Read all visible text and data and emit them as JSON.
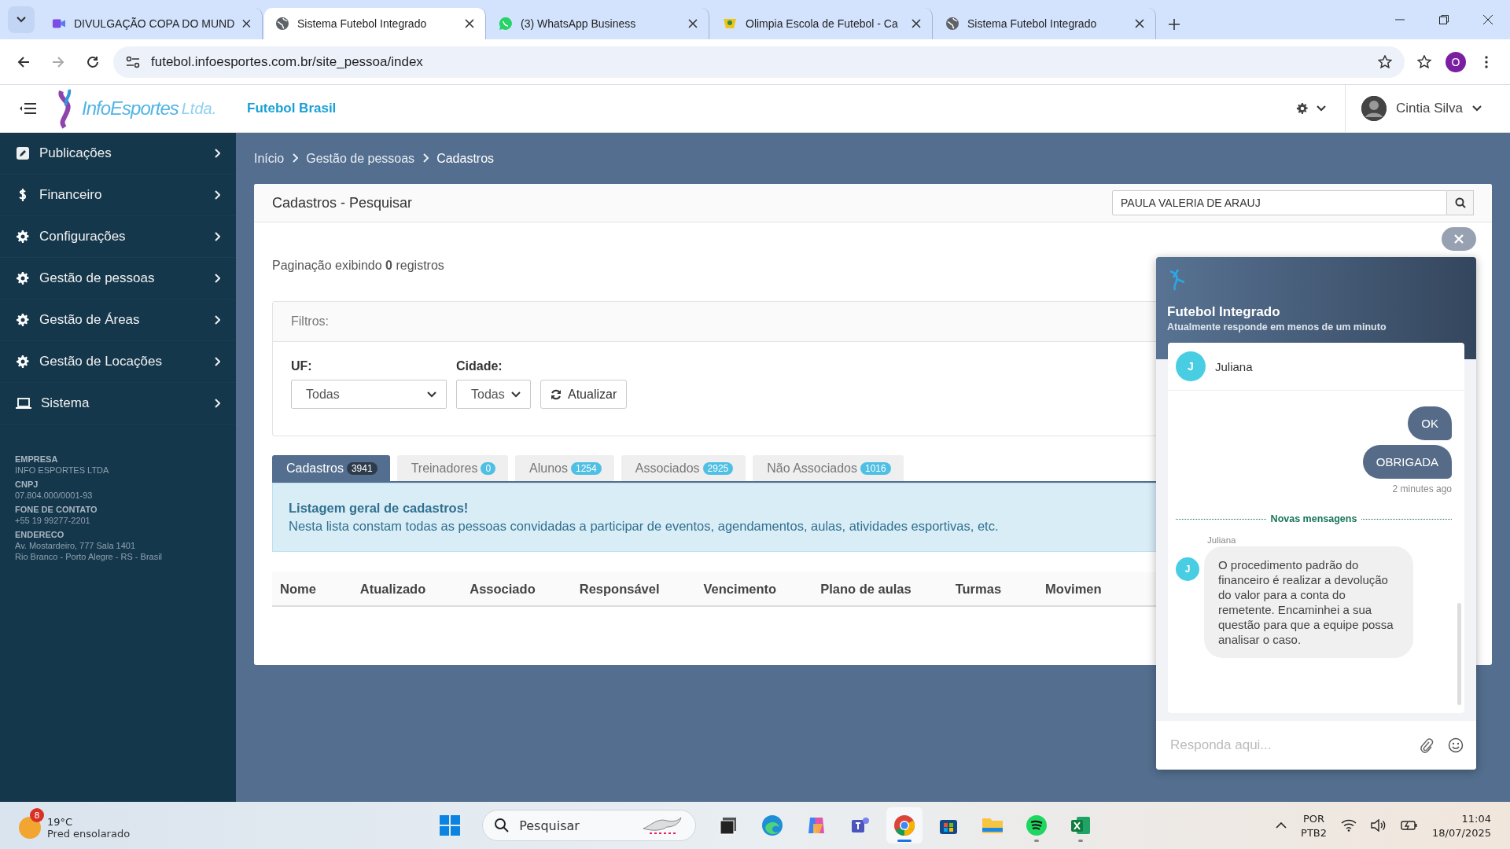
{
  "browser": {
    "tabs": [
      {
        "kind": "video",
        "title": "DIVULGAÇÃO COPA DO MUND",
        "selected": false
      },
      {
        "kind": "globe",
        "title": "Sistema Futebol Integrado",
        "selected": true
      },
      {
        "kind": "whatsapp",
        "title": "(3) WhatsApp Business",
        "selected": false
      },
      {
        "kind": "image",
        "title": "Olimpia Escola de Futebol - Ca",
        "selected": false
      },
      {
        "kind": "globe",
        "title": "Sistema Futebol Integrado",
        "selected": false
      }
    ],
    "url": "futebol.infoesportes.com.br/site_pessoa/index",
    "profile": "O"
  },
  "header": {
    "logo_main": "InfoEsportes",
    "logo_suffix": "Ltda.",
    "org": "Futebol Brasil",
    "user": "Cintia Silva"
  },
  "sidebar": {
    "items": [
      {
        "kind": "edit",
        "label": "Publicações"
      },
      {
        "kind": "money",
        "label": "Financeiro"
      },
      {
        "kind": "gear",
        "label": "Configurações"
      },
      {
        "kind": "gear",
        "label": "Gestão de pessoas"
      },
      {
        "kind": "gear",
        "label": "Gestão de Áreas"
      },
      {
        "kind": "gear",
        "label": "Gestão de Locações"
      },
      {
        "kind": "laptop",
        "label": "Sistema"
      }
    ],
    "info": [
      {
        "label": "EMPRESA",
        "lines": [
          "INFO ESPORTES LTDA"
        ]
      },
      {
        "label": "CNPJ",
        "lines": [
          "07.804.000/0001-93"
        ]
      },
      {
        "label": "FONE DE CONTATO",
        "lines": [
          "+55 19 99277-2201"
        ]
      },
      {
        "label": "ENDERECO",
        "lines": [
          "Av. Mostardeiro, 777 Sala 1401",
          "Rio Branco - Porto Alegre - RS - Brasil"
        ]
      }
    ]
  },
  "breadcrumb": [
    "Início",
    "Gestão de pessoas",
    "Cadastros"
  ],
  "card": {
    "title": "Cadastros - Pesquisar",
    "search": {
      "value": "PAULA VALERIA DE ARAUJ"
    },
    "pagination": "Paginação exibindo **0** registros",
    "filters": {
      "title": "Filtros:",
      "fields": [
        {
          "label": "UF:",
          "value": "Todas"
        },
        {
          "label": "Cidade:",
          "value": "Todas"
        }
      ],
      "button": "Atualizar"
    },
    "tabs": [
      {
        "label": "Cadastros",
        "count": "3941",
        "selected": true
      },
      {
        "label": "Treinadores",
        "count": "0",
        "selected": false
      },
      {
        "label": "Alunos",
        "count": "1254",
        "selected": false
      },
      {
        "label": "Associados",
        "count": "2925",
        "selected": false
      },
      {
        "label": "Não Associados",
        "count": "1016",
        "selected": false
      }
    ],
    "alert": {
      "title": "Listagem geral de cadastros!",
      "text": "Nesta lista constam todas as pessoas convidadas a participar de eventos, agendamentos, aulas, atividades esportivas, etc."
    },
    "columns": [
      "Nome",
      "Atualizado",
      "Associado",
      "Responsável",
      "Vencimento",
      "Plano de aulas",
      "Turmas",
      "Movimen"
    ]
  },
  "chat": {
    "title": "Futebol Integrado",
    "subtitle": "Atualmente responde em menos de um minuto",
    "agent": {
      "initial": "J",
      "name": "Juliana"
    },
    "messages": [
      {
        "kind": "outgoing",
        "text": "OK"
      },
      {
        "kind": "outgoing",
        "text": "OBRIGADA"
      },
      {
        "kind": "time",
        "text": "2 minutes ago"
      },
      {
        "kind": "divider",
        "text": "Novas mensagens"
      },
      {
        "kind": "incoming",
        "sender": "Juliana",
        "initial": "J",
        "text": "O procedimento padrão do financeiro é realizar a devolução do valor para a conta do remetente. Encaminhei a sua questão para que a equipe possa analisar o caso."
      }
    ],
    "placeholder": "Responda aqui..."
  },
  "taskbar": {
    "weather": {
      "badge": "8",
      "temp": "19°C",
      "desc": "Pred ensolarado"
    },
    "search": {
      "placeholder": "Pesquisar"
    },
    "apps": [
      {
        "kind": "taskview",
        "running": false,
        "selected": false
      },
      {
        "kind": "edge",
        "running": false,
        "selected": false
      },
      {
        "kind": "copilot",
        "running": false,
        "selected": false
      },
      {
        "kind": "teams",
        "running": false,
        "selected": false
      },
      {
        "kind": "chrome",
        "running": true,
        "selected": true
      },
      {
        "kind": "store",
        "running": false,
        "selected": false
      },
      {
        "kind": "folder",
        "running": false,
        "selected": false
      },
      {
        "kind": "spotify",
        "running": true,
        "selected": false
      },
      {
        "kind": "excel",
        "running": true,
        "selected": false
      }
    ],
    "lang": "POR",
    "layout": "PTB2",
    "time": "11:04",
    "date": "18/07/2025"
  }
}
